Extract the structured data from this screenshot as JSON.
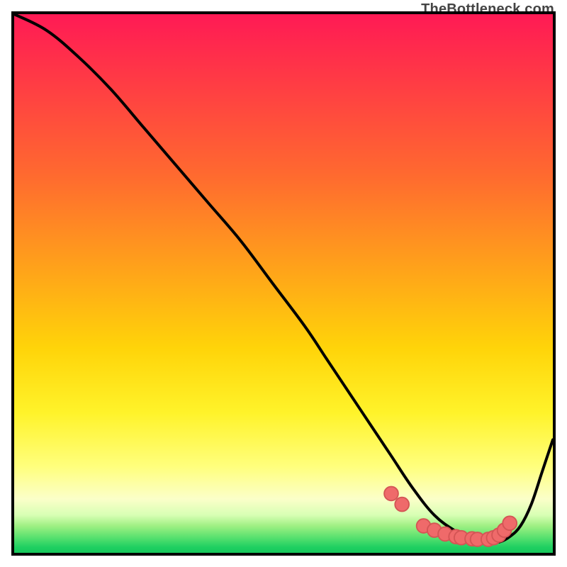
{
  "watermark": "TheBottleneck.com",
  "colors": {
    "gradient_top": "#ff1a55",
    "gradient_mid": "#ffd409",
    "gradient_bottom": "#18c85c",
    "curve_stroke": "#000000",
    "marker_fill": "#ef6a6a",
    "marker_stroke": "#d45555",
    "border": "#000000"
  },
  "chart_data": {
    "type": "line",
    "title": "",
    "xlabel": "",
    "ylabel": "",
    "xlim": [
      0,
      100
    ],
    "ylim": [
      0,
      100
    ],
    "axes_visible": false,
    "grid": false,
    "series": [
      {
        "name": "bottleneck-curve",
        "x": [
          0,
          6,
          12,
          18,
          24,
          30,
          36,
          42,
          48,
          54,
          58,
          62,
          66,
          70,
          74,
          78,
          82,
          86,
          88,
          90,
          92,
          94,
          96,
          98,
          100
        ],
        "y": [
          100,
          97,
          92,
          86,
          79,
          72,
          65,
          58,
          50,
          42,
          36,
          30,
          24,
          18,
          12,
          7,
          4,
          2,
          2,
          2,
          3,
          5,
          9,
          15,
          21
        ]
      }
    ],
    "markers": {
      "name": "valley-markers",
      "x": [
        70,
        72,
        76,
        78,
        80,
        82,
        83,
        85,
        86,
        88,
        89,
        90,
        91,
        92
      ],
      "y": [
        11,
        9,
        5,
        4.2,
        3.5,
        3,
        2.8,
        2.6,
        2.5,
        2.5,
        2.8,
        3.3,
        4.2,
        5.5
      ]
    }
  }
}
